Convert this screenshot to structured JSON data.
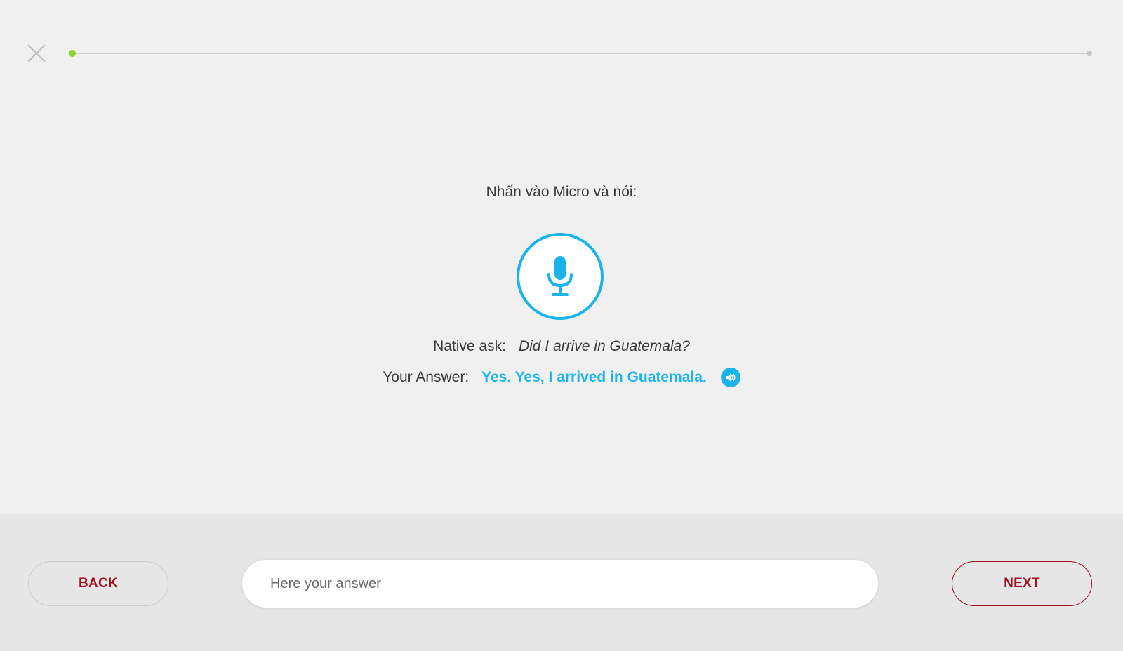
{
  "progress": {
    "value": 0.005
  },
  "prompt": {
    "instruction": "Nhấn vào Micro và nói:"
  },
  "native": {
    "label": "Native ask:",
    "text": "Did I arrive in Guatemala?"
  },
  "answer": {
    "label": "Your Answer:",
    "text": "Yes. Yes, I arrived in Guatemala."
  },
  "icons": {
    "close": "close-icon",
    "microphone": "microphone-icon",
    "speaker": "speaker-icon"
  },
  "footer": {
    "back_label": "BACK",
    "next_label": "NEXT",
    "input_placeholder": "Here your answer",
    "input_value": ""
  },
  "colors": {
    "accent_blue": "#1ab4ea",
    "brand_red": "#a01022",
    "progress_green": "#8ed12d"
  }
}
